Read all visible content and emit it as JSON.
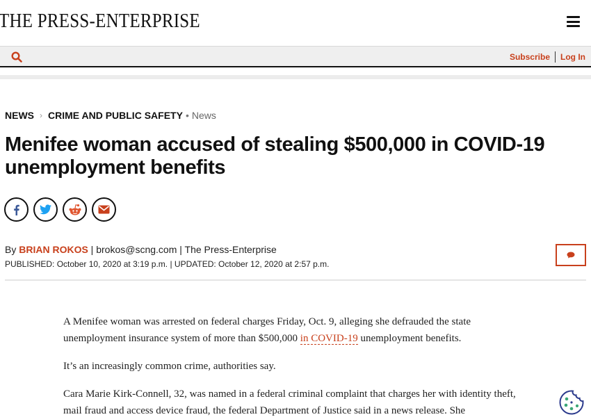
{
  "header": {
    "logo": "THE PRESS-ENTERPRISE",
    "menu_icon": "hamburger-menu-icon",
    "search_icon": "search-icon",
    "subscribe": "Subscribe",
    "login": "Log In"
  },
  "breadcrumb": {
    "section": "NEWS",
    "subsection": "CRIME AND PUBLIC SAFETY",
    "tag": "News"
  },
  "article": {
    "headline": "Menifee woman accused of stealing $500,000 in COVID-19 unemployment benefits",
    "byline_prefix": "By ",
    "author": "BRIAN ROKOS",
    "byline_rest": " | brokos@scng.com | The Press-Enterprise",
    "dates": "PUBLISHED: October 10, 2020 at 3:19 p.m. | UPDATED: October 12, 2020 at 2:57 p.m.",
    "p1_before": "A Menifee woman was arrested on federal charges Friday, Oct. 9, alleging she defrauded the state unemployment insurance system of more than $500,000 ",
    "p1_link": "in COVID-19",
    "p1_after": " unemployment benefits.",
    "p2": "It’s an increasingly common crime, authorities say.",
    "p3": "Cara Marie Kirk-Connell, 32, was named in a federal criminal complaint that charges her with identity theft, mail fraud and access device fraud, the federal Department of Justice said in a news release. She"
  },
  "share": {
    "icons": [
      "facebook-icon",
      "twitter-icon",
      "reddit-icon",
      "email-icon"
    ]
  },
  "colors": {
    "accent": "#c8401c",
    "facebook": "#3b5998",
    "twitter": "#1da1f2",
    "reddit": "#e0552f",
    "cookie": "#2b3a8c"
  }
}
